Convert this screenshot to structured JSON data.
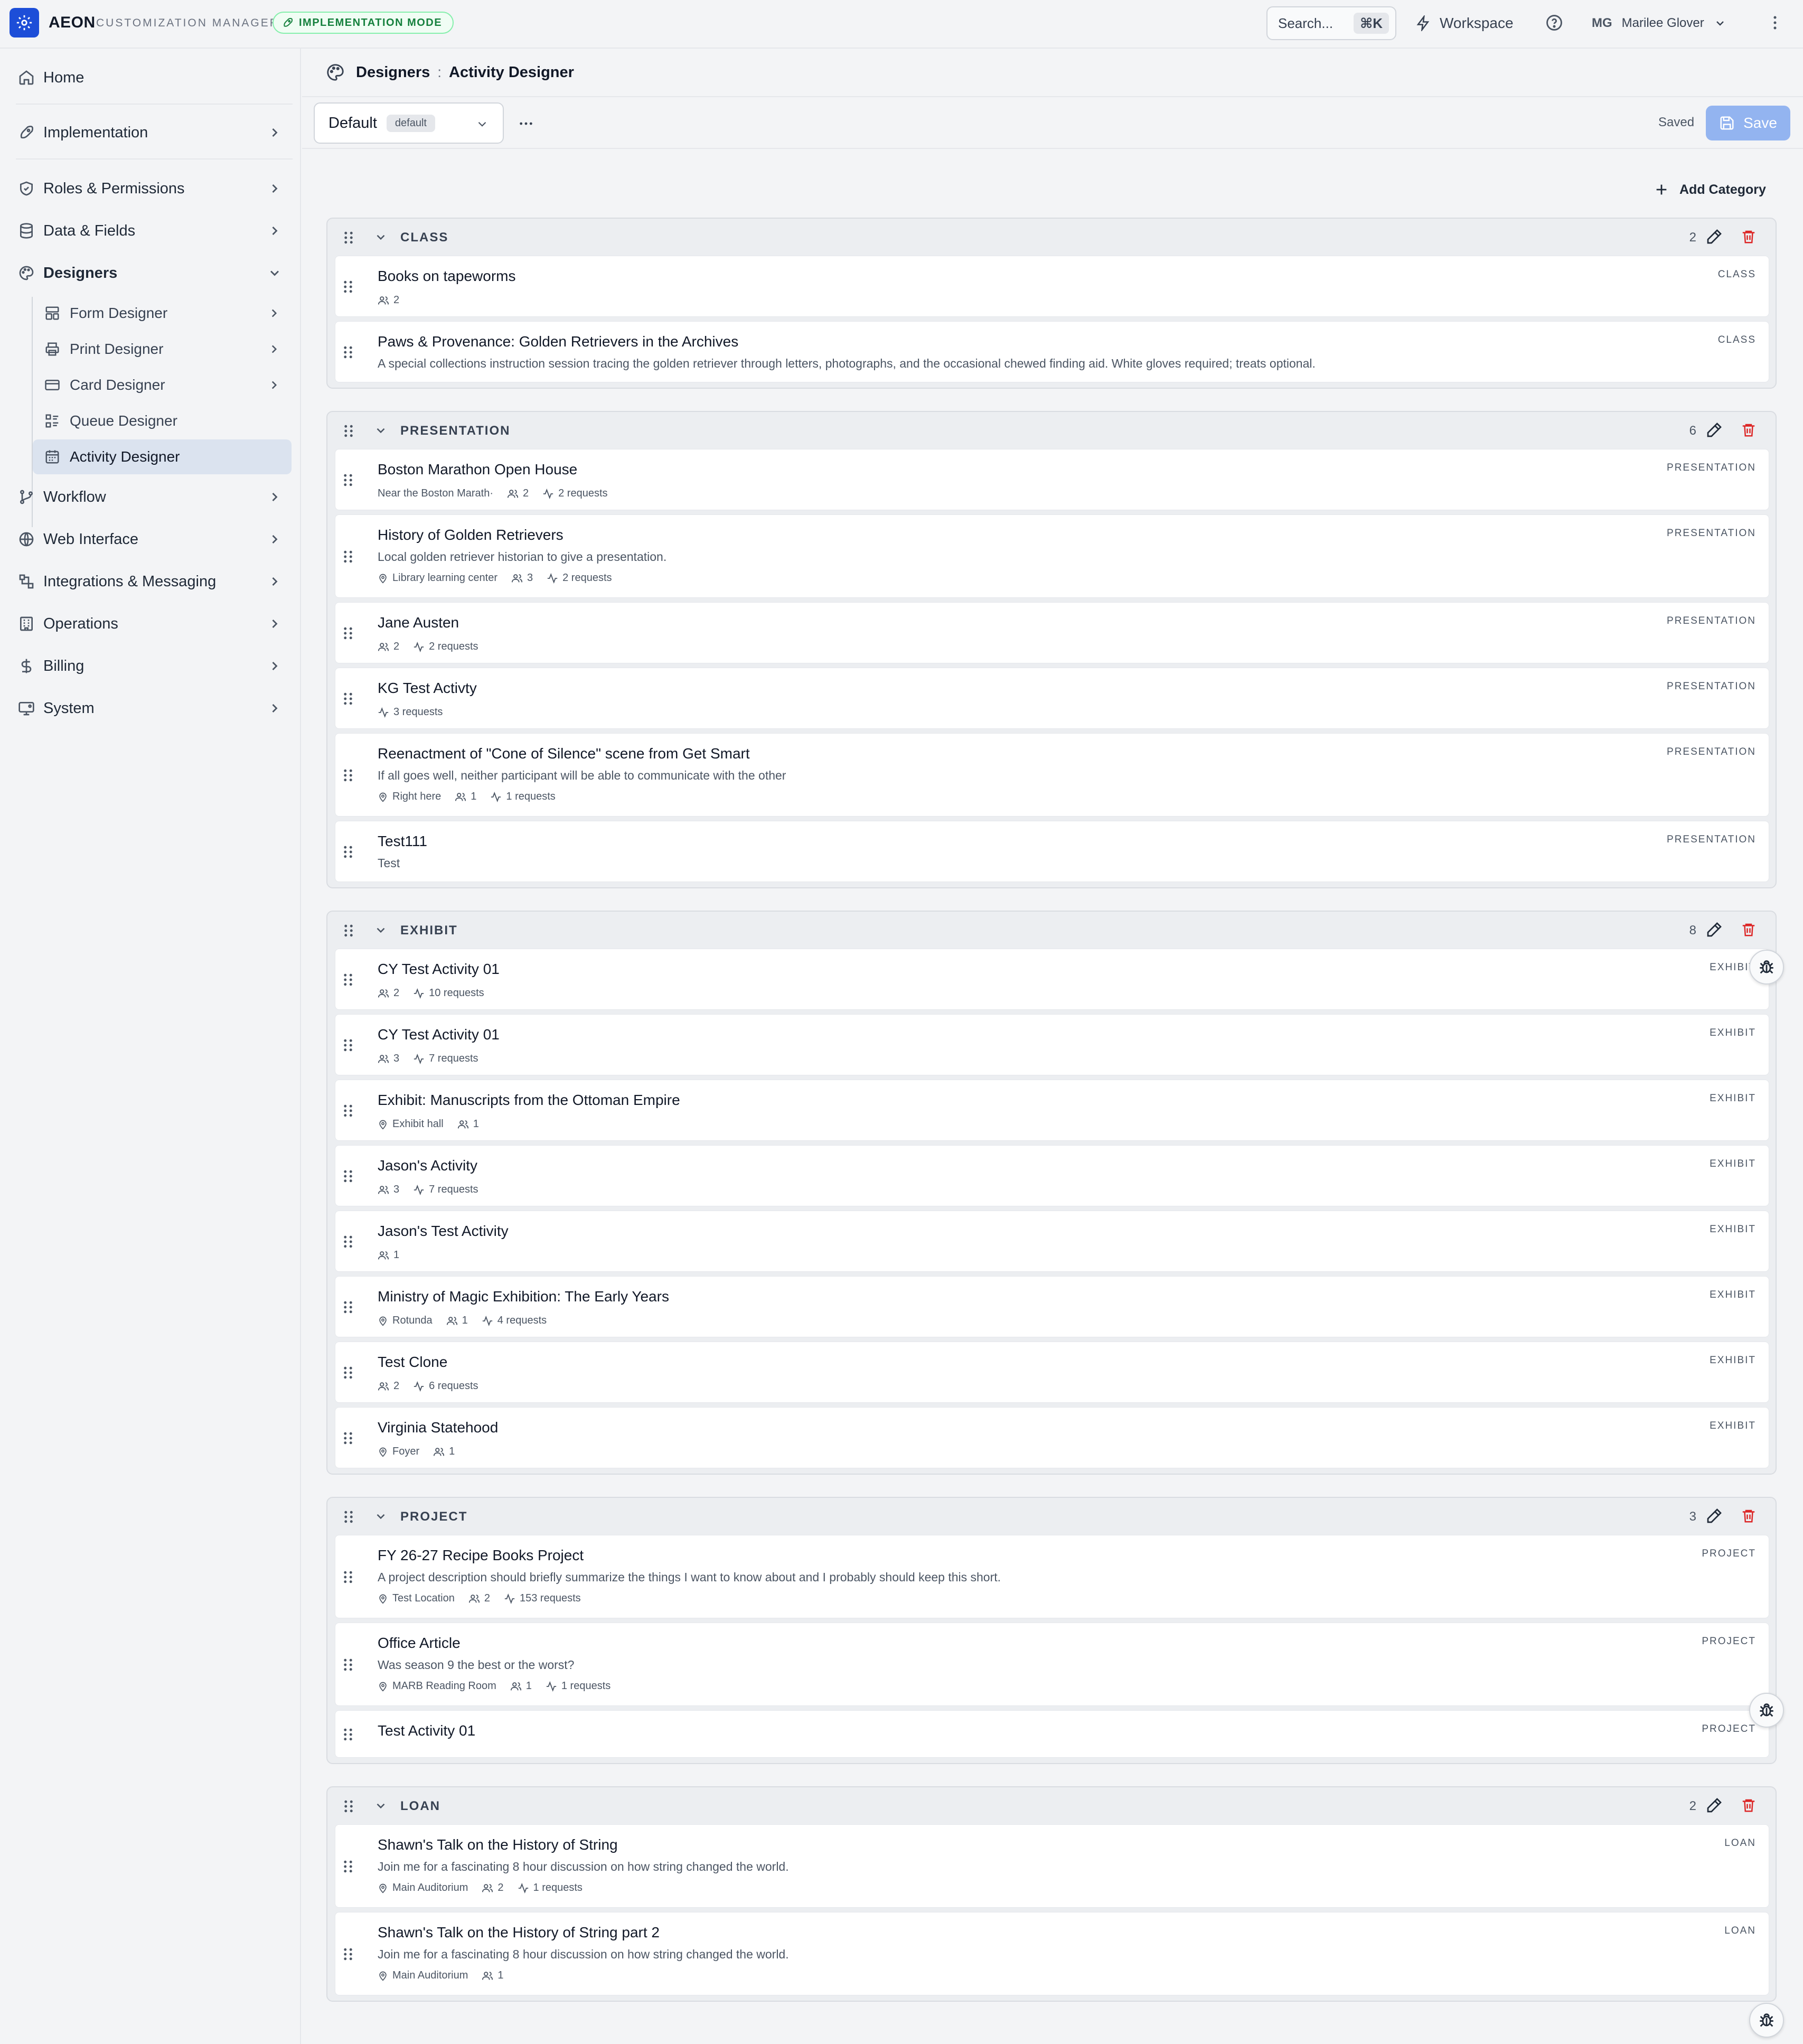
{
  "app": {
    "name": "AEON",
    "subtitle": "CUSTOMIZATION MANAGER",
    "mode_badge": "IMPLEMENTATION MODE",
    "accent_color": "#1d4ed8",
    "mode_color": "#15803d"
  },
  "topbar": {
    "search_placeholder": "Search...",
    "search_shortcut": "⌘K",
    "workspace_label": "Workspace",
    "user_initials": "MG",
    "user_name": "Marilee Glover"
  },
  "sidebar": {
    "home": "Home",
    "items": [
      {
        "label": "Implementation",
        "icon": "rocket-icon"
      },
      {
        "label": "Roles & Permissions",
        "icon": "shield-icon"
      },
      {
        "label": "Data & Fields",
        "icon": "database-icon"
      },
      {
        "label": "Designers",
        "icon": "palette-icon",
        "expanded": true
      },
      {
        "label": "Workflow",
        "icon": "branch-icon"
      },
      {
        "label": "Web Interface",
        "icon": "globe-icon"
      },
      {
        "label": "Integrations & Messaging",
        "icon": "integrations-icon"
      },
      {
        "label": "Operations",
        "icon": "building-icon"
      },
      {
        "label": "Billing",
        "icon": "dollar-icon"
      },
      {
        "label": "System",
        "icon": "monitor-icon"
      }
    ],
    "designers_sub": [
      {
        "label": "Form Designer",
        "icon": "form-icon",
        "has_chevron": true
      },
      {
        "label": "Print Designer",
        "icon": "printer-icon",
        "has_chevron": true
      },
      {
        "label": "Card Designer",
        "icon": "card-icon",
        "has_chevron": true
      },
      {
        "label": "Queue Designer",
        "icon": "queue-icon",
        "has_chevron": false
      },
      {
        "label": "Activity Designer",
        "icon": "calendar-icon",
        "has_chevron": false,
        "active": true
      }
    ]
  },
  "breadcrumb": {
    "parent": "Designers",
    "separator": ":",
    "current": "Activity Designer"
  },
  "toolbar": {
    "view_name": "Default",
    "view_badge": "default",
    "status": "Saved",
    "save_label": "Save",
    "add_category_label": "Add Category"
  },
  "categories": [
    {
      "name": "CLASS",
      "count": "2",
      "items": [
        {
          "title": "Books on tapeworms",
          "type": "CLASS",
          "meta": [
            {
              "icon": "users",
              "text": "2"
            }
          ]
        },
        {
          "title": "Paws & Provenance: Golden Retrievers in the Archives",
          "type": "CLASS",
          "description": "A special collections instruction session tracing the golden retriever through letters, photographs, and the occasional chewed finding aid. White gloves required; treats optional."
        }
      ]
    },
    {
      "name": "PRESENTATION",
      "count": "6",
      "items": [
        {
          "title": "Boston Marathon Open House",
          "type": "PRESENTATION",
          "meta": [
            {
              "icon": "none",
              "text": "Near the Boston Marath·"
            },
            {
              "icon": "users",
              "text": "2"
            },
            {
              "icon": "activity",
              "text": "2 requests"
            }
          ]
        },
        {
          "title": "History of Golden Retrievers",
          "type": "PRESENTATION",
          "description": "Local golden retriever historian to give a presentation.",
          "meta": [
            {
              "icon": "pin",
              "text": "Library learning center"
            },
            {
              "icon": "users",
              "text": "3"
            },
            {
              "icon": "activity",
              "text": "2 requests"
            }
          ]
        },
        {
          "title": "Jane Austen",
          "type": "PRESENTATION",
          "meta": [
            {
              "icon": "users",
              "text": "2"
            },
            {
              "icon": "activity",
              "text": "2 requests"
            }
          ]
        },
        {
          "title": "KG Test Activty",
          "type": "PRESENTATION",
          "meta": [
            {
              "icon": "activity",
              "text": "3 requests"
            }
          ]
        },
        {
          "title": "Reenactment of \"Cone of Silence\" scene from Get Smart",
          "type": "PRESENTATION",
          "description": "If all goes well, neither participant will be able to communicate with the other",
          "meta": [
            {
              "icon": "pin",
              "text": "Right here"
            },
            {
              "icon": "users",
              "text": "1"
            },
            {
              "icon": "activity",
              "text": "1 requests"
            }
          ]
        },
        {
          "title": "Test111",
          "type": "PRESENTATION",
          "description": "Test"
        }
      ]
    },
    {
      "name": "EXHIBIT",
      "count": "8",
      "items": [
        {
          "title": "CY Test Activity 01",
          "type": "EXHIBIT",
          "meta": [
            {
              "icon": "users",
              "text": "2"
            },
            {
              "icon": "activity",
              "text": "10 requests"
            }
          ]
        },
        {
          "title": "CY Test Activity 01",
          "type": "EXHIBIT",
          "meta": [
            {
              "icon": "users",
              "text": "3"
            },
            {
              "icon": "activity",
              "text": "7 requests"
            }
          ]
        },
        {
          "title": "Exhibit: Manuscripts from the Ottoman Empire",
          "type": "EXHIBIT",
          "meta": [
            {
              "icon": "pin",
              "text": "Exhibit hall"
            },
            {
              "icon": "users",
              "text": "1"
            }
          ]
        },
        {
          "title": "Jason's Activity",
          "type": "EXHIBIT",
          "meta": [
            {
              "icon": "users",
              "text": "3"
            },
            {
              "icon": "activity",
              "text": "7 requests"
            }
          ]
        },
        {
          "title": "Jason's Test Activity",
          "type": "EXHIBIT",
          "meta": [
            {
              "icon": "users",
              "text": "1"
            }
          ]
        },
        {
          "title": "Ministry of Magic Exhibition: The Early Years",
          "type": "EXHIBIT",
          "meta": [
            {
              "icon": "pin",
              "text": "Rotunda"
            },
            {
              "icon": "users",
              "text": "1"
            },
            {
              "icon": "activity",
              "text": "4 requests"
            }
          ]
        },
        {
          "title": "Test Clone",
          "type": "EXHIBIT",
          "meta": [
            {
              "icon": "users",
              "text": "2"
            },
            {
              "icon": "activity",
              "text": "6 requests"
            }
          ]
        },
        {
          "title": "Virginia Statehood",
          "type": "EXHIBIT",
          "meta": [
            {
              "icon": "pin",
              "text": "Foyer"
            },
            {
              "icon": "users",
              "text": "1"
            }
          ]
        }
      ]
    },
    {
      "name": "PROJECT",
      "count": "3",
      "items": [
        {
          "title": "FY 26-27 Recipe Books Project",
          "type": "PROJECT",
          "description": "A project description should briefly summarize the things I want to know about and I probably should keep this short.",
          "meta": [
            {
              "icon": "pin",
              "text": "Test Location"
            },
            {
              "icon": "users",
              "text": "2"
            },
            {
              "icon": "activity",
              "text": "153 requests"
            }
          ]
        },
        {
          "title": "Office Article",
          "type": "PROJECT",
          "description": "Was season 9 the best or the worst?",
          "meta": [
            {
              "icon": "pin",
              "text": "MARB Reading Room"
            },
            {
              "icon": "users",
              "text": "1"
            },
            {
              "icon": "activity",
              "text": "1 requests"
            }
          ]
        },
        {
          "title": "Test Activity 01",
          "type": "PROJECT"
        }
      ]
    },
    {
      "name": "LOAN",
      "count": "2",
      "items": [
        {
          "title": "Shawn's Talk on the History of String",
          "type": "LOAN",
          "description": "Join me for a fascinating 8 hour discussion on how string changed the world.",
          "meta": [
            {
              "icon": "pin",
              "text": "Main Auditorium"
            },
            {
              "icon": "users",
              "text": "2"
            },
            {
              "icon": "activity",
              "text": "1 requests"
            }
          ]
        },
        {
          "title": "Shawn's Talk on the History of String part 2",
          "type": "LOAN",
          "description": "Join me for a fascinating 8 hour discussion on how string changed the world.",
          "meta": [
            {
              "icon": "pin",
              "text": "Main Auditorium"
            },
            {
              "icon": "users",
              "text": "1"
            }
          ]
        }
      ]
    }
  ]
}
